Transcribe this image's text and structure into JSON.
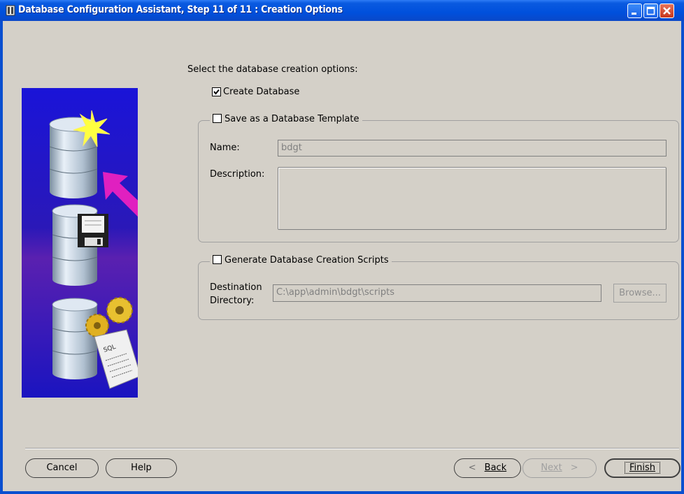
{
  "window": {
    "title": "Database Configuration Assistant, Step 11 of 11 : Creation Options",
    "controls": [
      "minimize",
      "maximize",
      "close"
    ]
  },
  "main": {
    "prompt": "Select the database creation options:",
    "create_database": {
      "label": "Create Database",
      "checked": true
    },
    "template_group": {
      "label": "Save as a Database Template",
      "checked": false,
      "name_label": "Name:",
      "name_value": "bdgt",
      "description_label": "Description:",
      "description_value": ""
    },
    "scripts_group": {
      "label": "Generate Database Creation Scripts",
      "checked": false,
      "dest_label_line1": "Destination",
      "dest_label_line2": "Directory:",
      "dest_value": "C:\\app\\admin\\bdgt\\scripts",
      "browse_label": "Browse..."
    }
  },
  "footer": {
    "cancel": "Cancel",
    "help": "Help",
    "back": "Back",
    "next": "Next",
    "finish": "Finish"
  },
  "colors": {
    "titlebar": "#0a5ae0",
    "dialog_bg": "#d4d0c8",
    "illustration_bg": "#1a14c8",
    "arrow": "#e020c0"
  },
  "icons": [
    "app-icon",
    "minimize-icon",
    "maximize-icon",
    "close-icon",
    "back-arrow-icon",
    "next-arrow-icon"
  ]
}
